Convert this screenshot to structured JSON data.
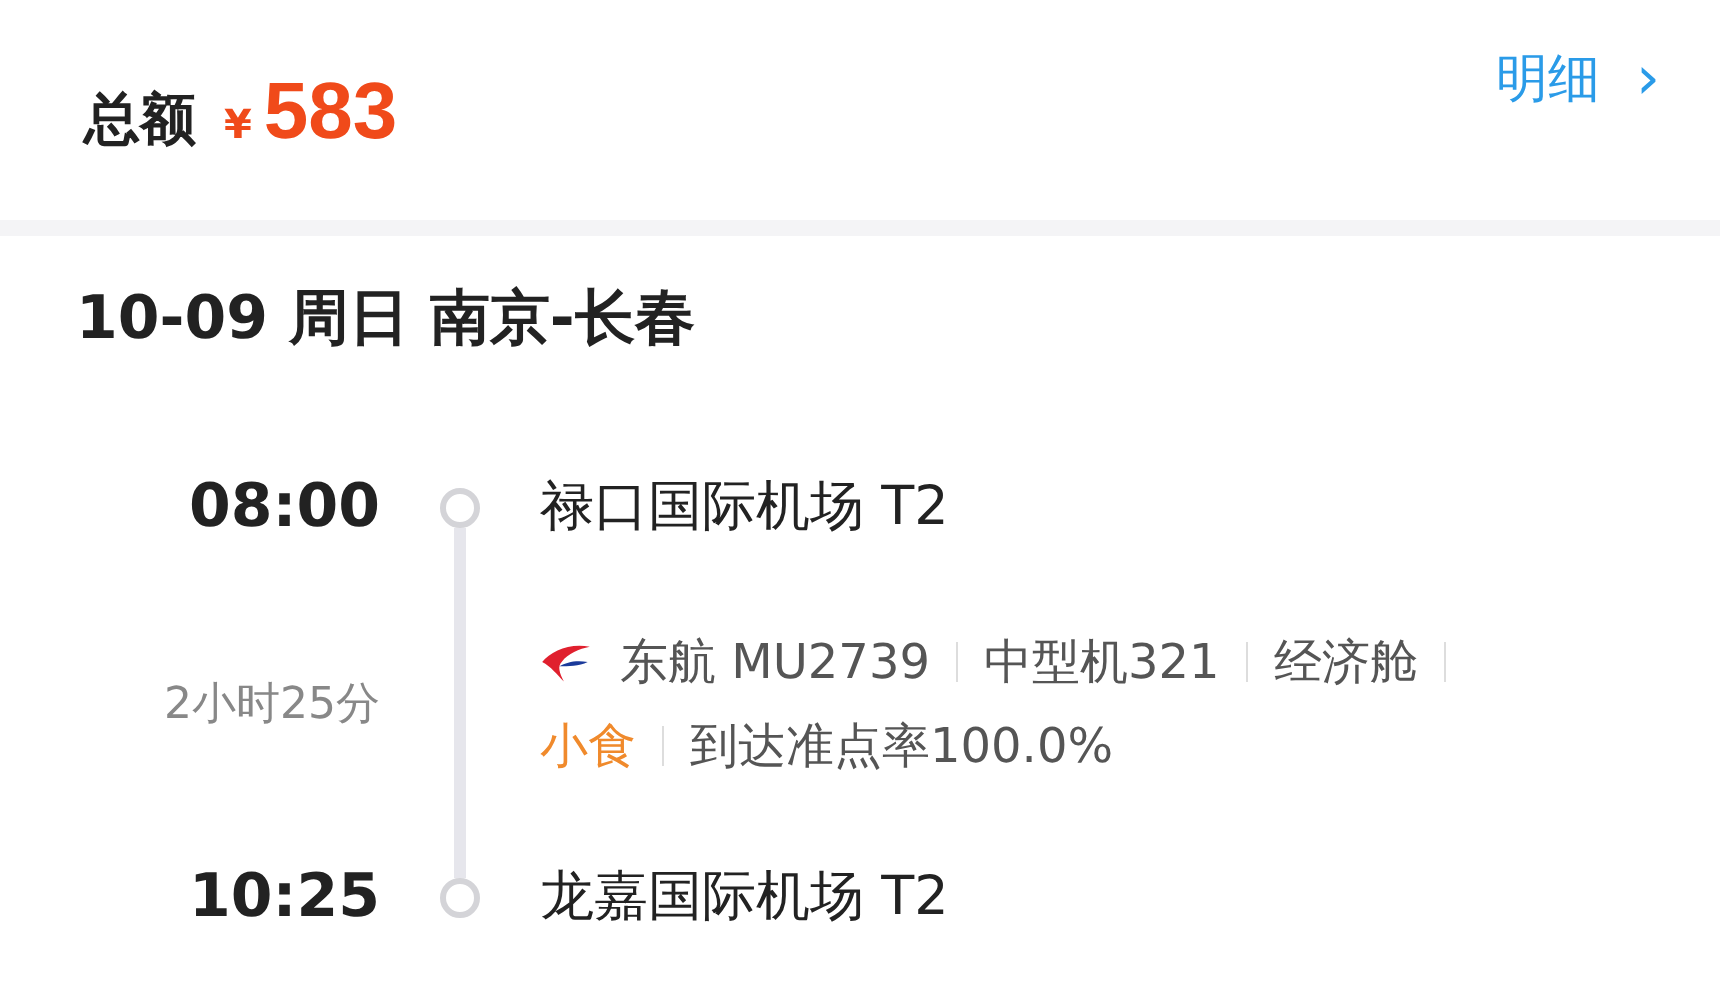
{
  "total": {
    "label": "总额",
    "currency": "¥",
    "amount": "583"
  },
  "detail_link": {
    "label": "明细",
    "arrow": "›"
  },
  "trip": {
    "title": "10-09 周日 南京-长春",
    "departure": {
      "time": "08:00",
      "airport": "禄口国际机场 T2"
    },
    "duration": "2小时25分",
    "info_rows": [
      [
        {
          "text": "东航 MU2739",
          "kind": "normal"
        },
        {
          "text": "中型机321",
          "kind": "normal"
        },
        {
          "text": "经济舱",
          "kind": "normal"
        }
      ],
      [
        {
          "text": "小食",
          "kind": "highlight"
        },
        {
          "text": "到达准点率100.0%",
          "kind": "normal"
        }
      ]
    ],
    "arrival": {
      "time": "10:25",
      "airport": "龙嘉国际机场 T2"
    }
  }
}
